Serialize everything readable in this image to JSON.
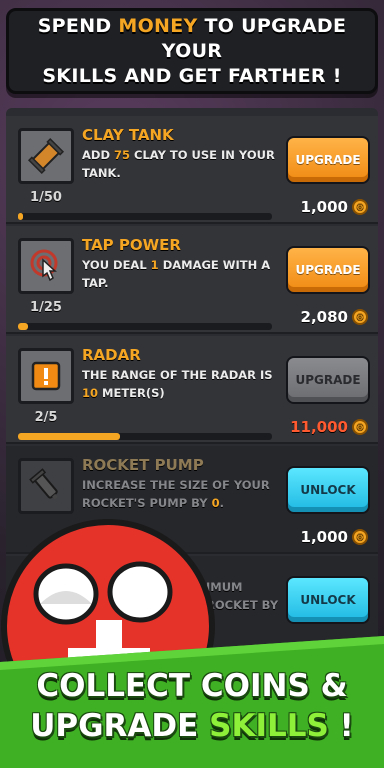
{
  "banner": {
    "line1_a": "SPEND ",
    "line1_highlight": "MONEY",
    "line1_b": " TO UPGRADE YOUR",
    "line2": "SKILLS AND GET FARTHER !"
  },
  "upgrades": [
    {
      "title": "CLAY TANK",
      "desc_a": "ADD ",
      "desc_num": "75",
      "desc_b": " CLAY TO USE IN YOUR TANK.",
      "count": "1/50",
      "progress": 0.02,
      "button": "UPGRADE",
      "price": "1,000",
      "icon": "clay-tank-icon"
    },
    {
      "title": "TAP POWER",
      "desc_a": "YOU DEAL ",
      "desc_num": "1",
      "desc_b": " DAMAGE WITH A TAP.",
      "count": "1/25",
      "progress": 0.04,
      "button": "UPGRADE",
      "price": "2,080",
      "icon": "tap-power-icon"
    },
    {
      "title": "RADAR",
      "desc_a": "THE RANGE OF THE RADAR IS ",
      "desc_num": "10",
      "desc_b": " METER(S)",
      "count": "2/5",
      "progress": 0.4,
      "button": "UPGRADE",
      "price": "11,000",
      "icon": "radar-warning-icon"
    },
    {
      "title": "ROCKET PUMP",
      "desc_a": "INCREASE THE SIZE OF YOUR ROCKET'S PUMP BY ",
      "desc_num": "0",
      "desc_b": ".",
      "button": "UNLOCK",
      "price": "1,000",
      "icon": "rocket-pump-icon"
    },
    {
      "desc_a": "IMUM",
      "desc_b": "ROCKET BY",
      "button": "UNLOCK"
    }
  ],
  "footer": {
    "line1": "COLLECT COINS &",
    "line2_a": "UPGRADE ",
    "line2_highlight": "SKILLS",
    "line2_b": " !"
  },
  "colors": {
    "accent_orange": "#f5a623",
    "button_orange": "#f08a12",
    "button_cyan": "#1fb8e2",
    "footer_green": "#3fb023",
    "price_red": "#ff5a30"
  }
}
